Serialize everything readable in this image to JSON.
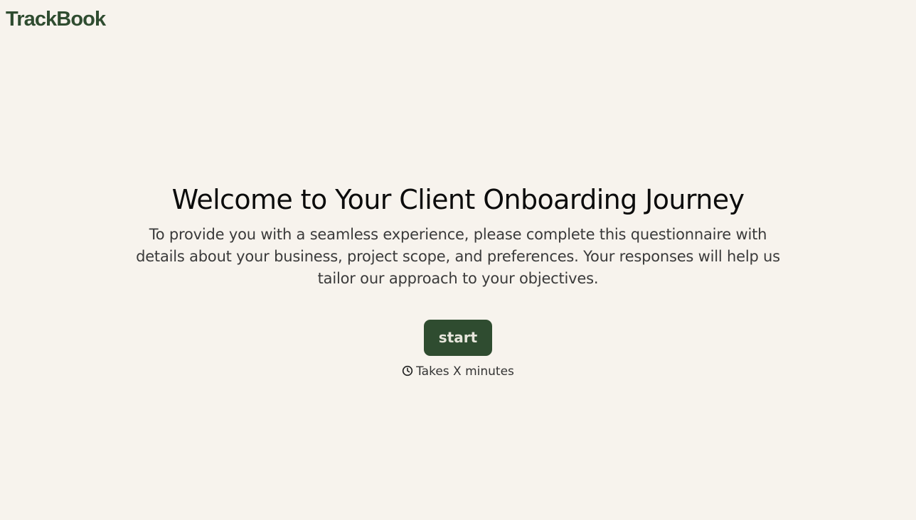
{
  "brand": {
    "logo_text": "TrackBook"
  },
  "main": {
    "title": "Welcome to Your Client Onboarding Journey",
    "description": "To provide you with a seamless experience, please complete this questionnaire with details about your business, project scope, and preferences. Your responses will help us tailor our approach to your objectives.",
    "start_label": "start",
    "duration_text": "Takes X minutes",
    "duration_icon": "clock-icon"
  },
  "colors": {
    "background": "#f7f3ed",
    "brand": "#2f4c30",
    "button_text": "#e7e6dc"
  }
}
